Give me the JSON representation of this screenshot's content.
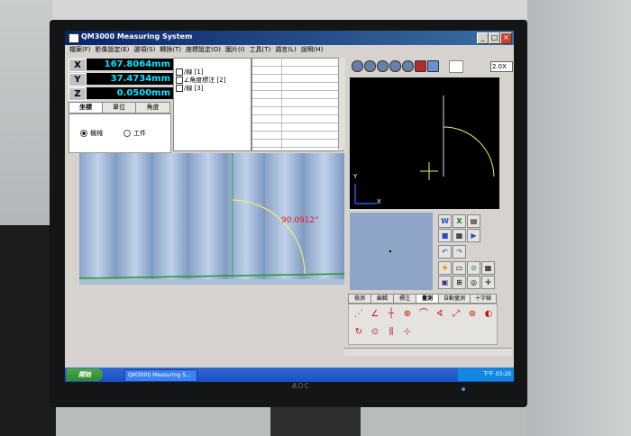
{
  "window": {
    "title": "QM3000 Measuring System",
    "buttons": [
      "_",
      "□",
      "×"
    ]
  },
  "menu": [
    "檔案(F)",
    "影像設定(E)",
    "選項(S)",
    "轉換(T)",
    "座標設定(O)",
    "圖片(I)",
    "工具(T)",
    "語言(L)",
    "說明(H)"
  ],
  "dro": {
    "x_label": "X",
    "x_value": "167.8064mm",
    "y_label": "Y",
    "y_value": "37.4734mm",
    "z_label": "Z",
    "z_value": "0.0500mm"
  },
  "coord_tabs": [
    "坐標",
    "單位",
    "角度"
  ],
  "coord_mode": {
    "machine": "機械",
    "work": "工件",
    "selected": "machine"
  },
  "features": [
    {
      "label": "線 [1]"
    },
    {
      "label": "角度標注 [2]"
    },
    {
      "label": "線 [3]"
    }
  ],
  "camera": {
    "angle_label": "90.0912°"
  },
  "zoom": "2.0X",
  "graph": {
    "axis_y": "Y",
    "axis_x": "X"
  },
  "function_tabs": [
    "檢測",
    "編輯",
    "標注",
    "量測",
    "自動量測",
    "十字線"
  ],
  "taskbar": {
    "start": "開始",
    "task": "QM3000 Measuring S...",
    "clock": "下午 03:20"
  },
  "monitor_brand": "AOC",
  "colors": {
    "dro_text": "#00e5ff",
    "angle_text": "#e0201c",
    "arc": "#f2ee6a",
    "edge_line": "#1f9c2c"
  },
  "icons": {
    "toolbar": [
      "pointer-icon",
      "zoom-in-icon",
      "zoom-out-icon",
      "zoom-fit-icon",
      "zoom-window-icon",
      "cube-icon",
      "grid-icon"
    ],
    "func": [
      "point-icon",
      "line-icon",
      "cross-icon",
      "circle-icon",
      "arc-icon",
      "angle-icon",
      "distance-icon",
      "ellipse-icon",
      "radius-icon",
      "slot-icon",
      "center-icon",
      "symmetry-icon",
      "peak-icon"
    ]
  }
}
